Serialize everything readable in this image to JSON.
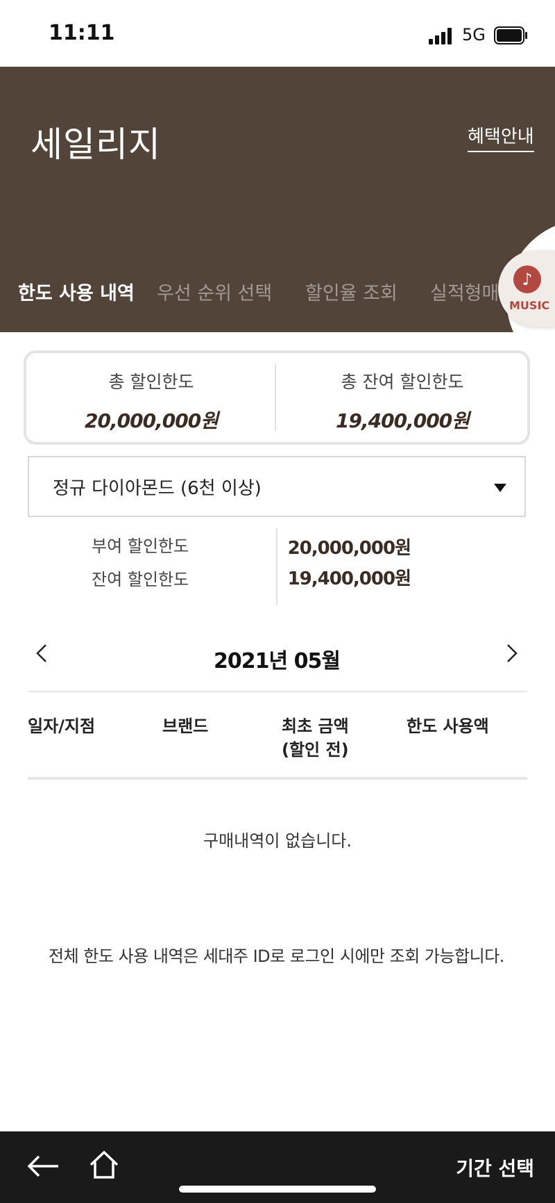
{
  "status_bar": {
    "time": "11:11",
    "network": "5G"
  },
  "header": {
    "title": "세일리지",
    "benefit_link": "혜택안내",
    "tabs": [
      {
        "label": "한도 사용 내역",
        "active": true
      },
      {
        "label": "우선 순위 선택",
        "active": false
      },
      {
        "label": "할인율 조회",
        "active": false
      },
      {
        "label": "실적형매출조",
        "active": false
      }
    ]
  },
  "music": {
    "label": "MUSIC",
    "icon": "music-note-icon"
  },
  "summary": {
    "total_limit_label": "총 할인한도",
    "total_limit_value": "20,000,000원",
    "remaining_limit_label": "총 잔여 할인한도",
    "remaining_limit_value": "19,400,000원"
  },
  "grade": {
    "selected": "정규 다이아몬드 (6천 이상)",
    "granted_label": "부여 할인한도",
    "granted_value": "20,000,000원",
    "remaining_label": "잔여 할인한도",
    "remaining_value": "19,400,000원"
  },
  "month_nav": {
    "label": "2021년 05월"
  },
  "table": {
    "headers": [
      "일자/지점",
      "브랜드",
      "최초 금액",
      "(할인 전)",
      "한도 사용액"
    ],
    "empty_message": "구매내역이 없습니다."
  },
  "notice": "전체 한도 사용 내역은 세대주 ID로 로그인 시에만 조회 가능합니다.",
  "bottom_bar": {
    "period_button": "기간 선택"
  },
  "colors": {
    "header_bg": "#53443a",
    "accent_text": "#3a2c22",
    "bottom_bar_bg": "#1a1a1a",
    "music_accent": "#b2483f"
  }
}
